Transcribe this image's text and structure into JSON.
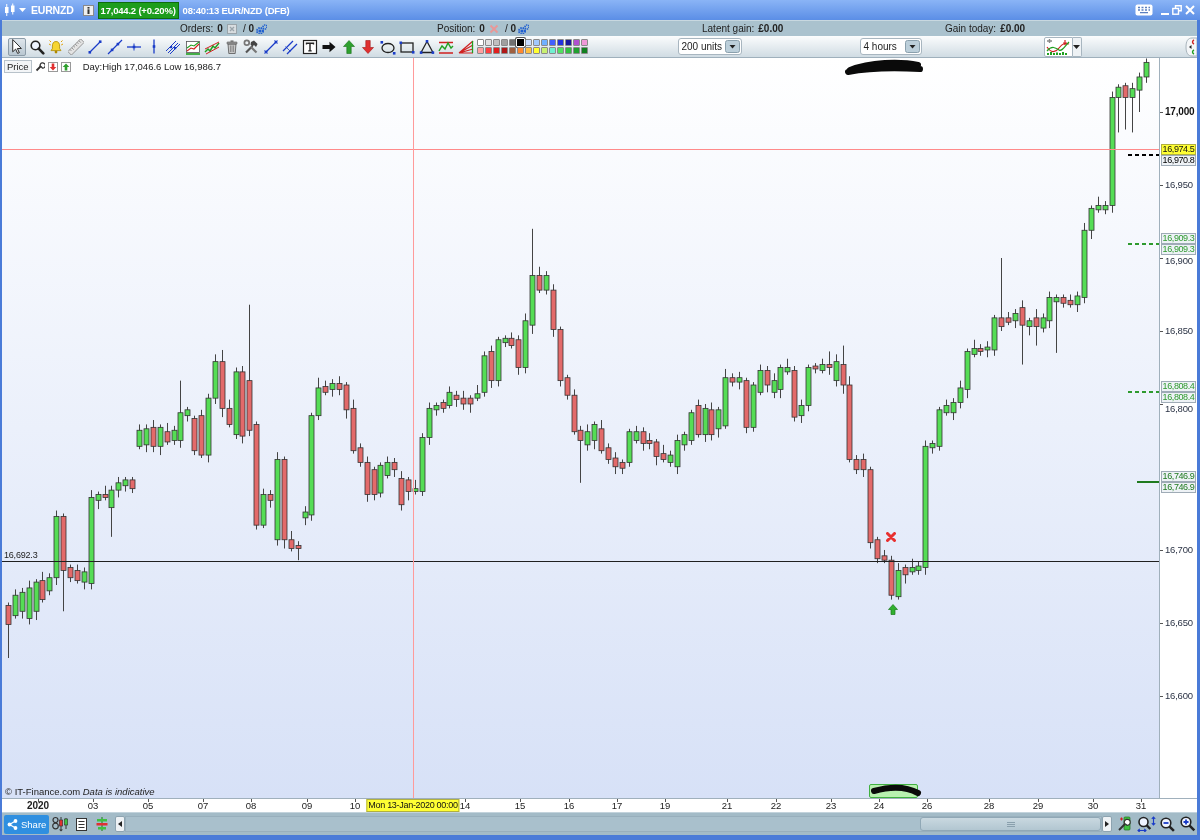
{
  "title_bar": {
    "instrument": "EURNZD",
    "quote": "17,044.2 (+0.20%)",
    "time_market": "08:40:13 EUR/NZD (DFB)"
  },
  "info_bar": [
    {
      "kind": "orders",
      "label": "Orders:",
      "value": "0",
      "total": "/ **0**"
    },
    {
      "kind": "position",
      "label": "Position:",
      "value": "0",
      "total": "/ **0**"
    },
    {
      "kind": "gain",
      "label": "Latent gain:",
      "value": "£0.00"
    },
    {
      "kind": "gain",
      "label": "Gain today:",
      "value": "£0.00"
    }
  ],
  "toolbar": {
    "tools": [
      {
        "kind": "pointer",
        "selected": true
      },
      {
        "kind": "zoom",
        "selected": false
      },
      {
        "kind": "alarm",
        "selected": false
      },
      {
        "kind": "ruler",
        "selected": false
      },
      {
        "kind": "segment",
        "selected": false
      },
      {
        "kind": "line",
        "selected": false
      },
      {
        "kind": "horizontal",
        "selected": false
      },
      {
        "kind": "vertical",
        "selected": false
      },
      {
        "kind": "channel",
        "selected": false
      },
      {
        "kind": "regression",
        "selected": false
      },
      {
        "kind": "trend",
        "selected": false
      },
      {
        "kind": "delete",
        "selected": false
      },
      {
        "kind": "tools",
        "selected": false
      },
      {
        "kind": "diagonal",
        "selected": false
      },
      {
        "kind": "parallel",
        "selected": false
      },
      {
        "kind": "text",
        "selected": false
      },
      {
        "kind": "arrow",
        "selected": false
      },
      {
        "kind": "arrowup",
        "selected": false
      },
      {
        "kind": "arrowdown",
        "selected": false
      },
      {
        "kind": "ellipse",
        "selected": false
      },
      {
        "kind": "rectangle",
        "selected": false
      },
      {
        "kind": "triangle",
        "selected": false
      },
      {
        "kind": "fibonacci",
        "selected": false
      },
      {
        "kind": "fan",
        "selected": false
      }
    ],
    "palette": [
      {
        "color": "#ffffff",
        "selected": false
      },
      {
        "color": "#e0e0e0",
        "selected": false
      },
      {
        "color": "#c0c0c0",
        "selected": false
      },
      {
        "color": "#a0a0a0",
        "selected": false
      },
      {
        "color": "#707070",
        "selected": false
      },
      {
        "color": "#000000",
        "selected": true
      },
      {
        "color": "#c8dcff",
        "selected": false
      },
      {
        "color": "#a0c8ff",
        "selected": false
      },
      {
        "color": "#70b0ff",
        "selected": false
      },
      {
        "color": "#4060ff",
        "selected": false
      },
      {
        "color": "#2030e0",
        "selected": false
      },
      {
        "color": "#1818a0",
        "selected": false
      },
      {
        "color": "#b050d0",
        "selected": false
      },
      {
        "color": "#f098d8",
        "selected": false
      },
      {
        "color": "#ffa0a0",
        "selected": false
      },
      {
        "color": "#ff4040",
        "selected": false
      },
      {
        "color": "#e02020",
        "selected": false
      },
      {
        "color": "#b01818",
        "selected": false
      },
      {
        "color": "#a06040",
        "selected": false
      },
      {
        "color": "#ff8830",
        "selected": false
      },
      {
        "color": "#ffc040",
        "selected": false
      },
      {
        "color": "#ffff30",
        "selected": false
      },
      {
        "color": "#c8f070",
        "selected": false
      },
      {
        "color": "#70f0d0",
        "selected": false
      },
      {
        "color": "#50e060",
        "selected": false
      },
      {
        "color": "#30c040",
        "selected": false
      },
      {
        "color": "#20a030",
        "selected": false
      },
      {
        "color": "#108020",
        "selected": false
      }
    ],
    "quantity": {
      "value": "200 units"
    },
    "interval": {
      "value": "4 hours"
    }
  },
  "chart": {
    "header": {
      "label": "Price",
      "day_range": "Day:High 17,046.6 Low 16,986.7"
    },
    "chart_data": {
      "type": "candlestick",
      "categories": [
        null,
        null,
        null,
        null,
        "2020",
        null,
        null,
        null,
        null,
        null,
        null,
        null,
        "03",
        null,
        null,
        null,
        null,
        null,
        null,
        null,
        "05",
        null,
        null,
        null,
        null,
        null,
        null,
        null,
        "07",
        null,
        null,
        null,
        null,
        null,
        null,
        "08",
        null,
        null,
        null,
        null,
        null,
        null,
        null,
        "09",
        null,
        null,
        null,
        null,
        null,
        null,
        "10",
        null,
        null,
        null,
        null,
        null,
        null,
        null,
        null,
        null,
        null,
        null,
        null,
        null,
        null,
        null,
        "14",
        null,
        null,
        null,
        null,
        null,
        null,
        null,
        "15",
        null,
        null,
        null,
        null,
        null,
        null,
        "16",
        null,
        null,
        null,
        null,
        null,
        null,
        "17",
        null,
        null,
        null,
        null,
        null,
        null,
        "19",
        null,
        null,
        null,
        null,
        null,
        null,
        null,
        null,
        "21",
        null,
        null,
        null,
        null,
        null,
        null,
        "22",
        null,
        null,
        null,
        null,
        null,
        null,
        null,
        "23",
        null,
        null,
        null,
        null,
        null,
        null,
        "24",
        null,
        null,
        null,
        null,
        null,
        null,
        "26",
        null,
        null,
        null,
        null,
        null,
        null,
        null,
        null,
        "28",
        null,
        null,
        null,
        null,
        null,
        null,
        "29",
        null,
        null,
        null,
        null,
        null,
        null,
        null,
        "30",
        null,
        null,
        null,
        null,
        null,
        null,
        "31",
        null
      ],
      "ohlc": [
        [
          16662,
          16664,
          16626,
          16649
        ],
        [
          16655,
          16673,
          16653,
          16669
        ],
        [
          16658,
          16674,
          16653,
          16671
        ],
        [
          16653,
          16679,
          16649,
          16674
        ],
        [
          16658,
          16680,
          16652,
          16678
        ],
        [
          16679,
          16685,
          16664,
          16666
        ],
        [
          16672,
          16684,
          16669,
          16681
        ],
        [
          16681,
          16727,
          16676,
          16723
        ],
        [
          16723,
          16725,
          16658,
          16686
        ],
        [
          16688,
          16690,
          16678,
          16681
        ],
        [
          16686,
          16690,
          16677,
          16679
        ],
        [
          16678,
          16688,
          16673,
          16685
        ],
        [
          16677,
          16741,
          16673,
          16736
        ],
        [
          16734,
          16740,
          16728,
          16738
        ],
        [
          16738,
          16744,
          16734,
          16736
        ],
        [
          16729,
          16744,
          16709,
          16741
        ],
        [
          16741,
          16750,
          16736,
          16746
        ],
        [
          16744,
          16750,
          16740,
          16748
        ],
        [
          16748,
          16750,
          16739,
          16742
        ],
        [
          16771,
          16786,
          16769,
          16782
        ],
        [
          16772,
          16786,
          16767,
          16783
        ],
        [
          16784,
          16789,
          16767,
          16771
        ],
        [
          16771,
          16786,
          16765,
          16784
        ],
        [
          16781,
          16787,
          16772,
          16774
        ],
        [
          16775,
          16785,
          16772,
          16782
        ],
        [
          16775,
          16816,
          16770,
          16794
        ],
        [
          16792,
          16798,
          16788,
          16796
        ],
        [
          16790,
          16792,
          16765,
          16768
        ],
        [
          16792,
          16796,
          16763,
          16765
        ],
        [
          16765,
          16807,
          16760,
          16804
        ],
        [
          16804,
          16834,
          16800,
          16829
        ],
        [
          16829,
          16837,
          16791,
          16797
        ],
        [
          16797,
          16803,
          16784,
          16786
        ],
        [
          16779,
          16825,
          16776,
          16822
        ],
        [
          16822,
          16826,
          16773,
          16778
        ],
        [
          16816,
          16868,
          16778,
          16782
        ],
        [
          16786,
          16788,
          16714,
          16717
        ],
        [
          16717,
          16742,
          16715,
          16738
        ],
        [
          16738,
          16741,
          16729,
          16734
        ],
        [
          16707,
          16767,
          16703,
          16762
        ],
        [
          16762,
          16764,
          16701,
          16707
        ],
        [
          16707,
          16713,
          16699,
          16701
        ],
        [
          16703,
          16706,
          16693,
          16701
        ],
        [
          16722,
          16730,
          16717,
          16726
        ],
        [
          16724,
          16794,
          16720,
          16792
        ],
        [
          16792,
          16818,
          16789,
          16811
        ],
        [
          16812,
          16816,
          16806,
          16808
        ],
        [
          16810,
          16817,
          16805,
          16814
        ],
        [
          16814,
          16819,
          16806,
          16810
        ],
        [
          16813,
          16815,
          16790,
          16796
        ],
        [
          16797,
          16803,
          16766,
          16768
        ],
        [
          16770,
          16773,
          16757,
          16760
        ],
        [
          16760,
          16764,
          16733,
          16738
        ],
        [
          16755,
          16757,
          16734,
          16738
        ],
        [
          16739,
          16760,
          16736,
          16758
        ],
        [
          16751,
          16764,
          16749,
          16760
        ],
        [
          16760,
          16763,
          16750,
          16755
        ],
        [
          16749,
          16754,
          16727,
          16731
        ],
        [
          16748,
          16750,
          16734,
          16740
        ],
        [
          16740,
          16748,
          16738,
          16742
        ],
        [
          16740,
          16780,
          16737,
          16777
        ],
        [
          16777,
          16801,
          16772,
          16797
        ],
        [
          16796,
          16801,
          16792,
          16799
        ],
        [
          16801,
          16803,
          16794,
          16797
        ],
        [
          16799,
          16812,
          16797,
          16808
        ],
        [
          16806,
          16809,
          16798,
          16803
        ],
        [
          16804,
          16809,
          16796,
          16800
        ],
        [
          16804,
          16806,
          16794,
          16800
        ],
        [
          16804,
          16813,
          16802,
          16807
        ],
        [
          16808,
          16836,
          16805,
          16833
        ],
        [
          16836,
          16840,
          16811,
          16816
        ],
        [
          16816,
          16846,
          16812,
          16844
        ],
        [
          16842,
          16847,
          16839,
          16845
        ],
        [
          16845,
          16849,
          16838,
          16840
        ],
        [
          16844,
          16847,
          16820,
          16825
        ],
        [
          16825,
          16862,
          16821,
          16857
        ],
        [
          16854,
          16920,
          16848,
          16888
        ],
        [
          16888,
          16894,
          16876,
          16878
        ],
        [
          16878,
          16891,
          16875,
          16888
        ],
        [
          16878,
          16882,
          16846,
          16851
        ],
        [
          16851,
          16853,
          16812,
          16816
        ],
        [
          16818,
          16820,
          16803,
          16806
        ],
        [
          16806,
          16810,
          16779,
          16781
        ],
        [
          16782,
          16785,
          16746,
          16775
        ],
        [
          16772,
          16786,
          16768,
          16781
        ],
        [
          16775,
          16788,
          16769,
          16786
        ],
        [
          16783,
          16789,
          16766,
          16768
        ],
        [
          16770,
          16773,
          16759,
          16762
        ],
        [
          16763,
          16767,
          16752,
          16757
        ],
        [
          16760,
          16762,
          16752,
          16756
        ],
        [
          16760,
          16783,
          16757,
          16781
        ],
        [
          16775,
          16785,
          16773,
          16781
        ],
        [
          16781,
          16784,
          16768,
          16773
        ],
        [
          16775,
          16780,
          16769,
          16773
        ],
        [
          16774,
          16776,
          16758,
          16764
        ],
        [
          16766,
          16772,
          16760,
          16762
        ],
        [
          16760,
          16768,
          16757,
          16765
        ],
        [
          16757,
          16779,
          16752,
          16775
        ],
        [
          16772,
          16781,
          16768,
          16779
        ],
        [
          16775,
          16796,
          16772,
          16794
        ],
        [
          16799,
          16803,
          16777,
          16779
        ],
        [
          16779,
          16800,
          16774,
          16797
        ],
        [
          16796,
          16801,
          16775,
          16779
        ],
        [
          16783,
          16798,
          16777,
          16796
        ],
        [
          16785,
          16824,
          16783,
          16818
        ],
        [
          16818,
          16821,
          16812,
          16815
        ],
        [
          16815,
          16822,
          16810,
          16818
        ],
        [
          16816,
          16818,
          16780,
          16784
        ],
        [
          16784,
          16815,
          16781,
          16813
        ],
        [
          16808,
          16827,
          16806,
          16823
        ],
        [
          16823,
          16826,
          16808,
          16813
        ],
        [
          16808,
          16821,
          16804,
          16816
        ],
        [
          16810,
          16827,
          16804,
          16825
        ],
        [
          16822,
          16831,
          16820,
          16825
        ],
        [
          16823,
          16826,
          16788,
          16791
        ],
        [
          16792,
          16803,
          16787,
          16799
        ],
        [
          16799,
          16827,
          16795,
          16825
        ],
        [
          16826,
          16828,
          16821,
          16824
        ],
        [
          16823,
          16831,
          16821,
          16827
        ],
        [
          16827,
          16836,
          16820,
          16825
        ],
        [
          16816,
          16834,
          16812,
          16829
        ],
        [
          16827,
          16840,
          16807,
          16813
        ],
        [
          16813,
          16819,
          16760,
          16762
        ],
        [
          16762,
          16765,
          16752,
          16755
        ],
        [
          16762,
          16766,
          16750,
          16755
        ],
        [
          16755,
          16757,
          16701,
          16705
        ],
        [
          16707,
          16709,
          16691,
          16694
        ],
        [
          16696,
          16700,
          16691,
          16693
        ],
        [
          16693,
          16696,
          16666,
          16669
        ],
        [
          16668,
          16691,
          16666,
          16686
        ],
        [
          16688,
          16690,
          16677,
          16683
        ],
        [
          16685,
          16694,
          16683,
          16688
        ],
        [
          16686,
          16692,
          16683,
          16689
        ],
        [
          16688,
          16775,
          16683,
          16771
        ],
        [
          16770,
          16775,
          16766,
          16773
        ],
        [
          16771,
          16798,
          16768,
          16796
        ],
        [
          16794,
          16803,
          16792,
          16799
        ],
        [
          16794,
          16804,
          16789,
          16801
        ],
        [
          16801,
          16816,
          16797,
          16811
        ],
        [
          16810,
          16838,
          16804,
          16836
        ],
        [
          16834,
          16844,
          16832,
          16838
        ],
        [
          16838,
          16841,
          16833,
          16836
        ],
        [
          16837,
          16843,
          16832,
          16839
        ],
        [
          16837,
          16861,
          16833,
          16859
        ],
        [
          16859,
          16900,
          16850,
          16853
        ],
        [
          16859,
          16863,
          16854,
          16856
        ],
        [
          16857,
          16865,
          16852,
          16862
        ],
        [
          16866,
          16871,
          16827,
          16854
        ],
        [
          16853,
          16859,
          16847,
          16857
        ],
        [
          16859,
          16865,
          16840,
          16853
        ],
        [
          16852,
          16862,
          16849,
          16859
        ],
        [
          16857,
          16877,
          16852,
          16873
        ],
        [
          16870,
          16875,
          16835,
          16873
        ],
        [
          16873,
          16875,
          16866,
          16869
        ],
        [
          16871,
          16875,
          16866,
          16868
        ],
        [
          16868,
          16877,
          16863,
          16874
        ],
        [
          16873,
          16924,
          16869,
          16919
        ],
        [
          16919,
          16936,
          16913,
          16934
        ],
        [
          16933,
          16942,
          16931,
          16936
        ],
        [
          16933,
          16939,
          16930,
          16936
        ],
        [
          16936,
          17014,
          16931,
          17010
        ],
        [
          17010,
          17019,
          16986,
          17017
        ],
        [
          17018,
          17020,
          16988,
          17010
        ],
        [
          17010,
          17020,
          16986,
          17016
        ],
        [
          17015,
          17027,
          17000,
          17024
        ],
        [
          17024,
          17039,
          17020,
          17034
        ]
      ],
      "ylim": [
        16530.1,
        17037.0
      ],
      "yticks": [
        {
          "value": 17000,
          "label": "17,000"
        },
        {
          "value": 16950,
          "label": "16,950"
        },
        {
          "value": 16900,
          "label": "16,900"
        },
        {
          "value": 16850,
          "label": "16,850"
        },
        {
          "value": 16800,
          "label": "16,800"
        },
        {
          "value": 16700,
          "label": "16,700"
        },
        {
          "value": 16650,
          "label": "16,650"
        },
        {
          "value": 16600,
          "label": "16,600"
        }
      ],
      "ref_lines": [
        {
          "axis": "y",
          "value": 16974.5,
          "color": "#ff8a8a"
        },
        {
          "axis": "y",
          "value": 16692.3,
          "color": "#202020",
          "label": "16,692.3"
        }
      ]
    },
    "crosshair": {
      "price": "16,974.5",
      "date": "Mon 13-Jan-2020 00:00"
    },
    "levels": [
      {
        "kind": "dashed",
        "color": "#000000",
        "tags": [
          "16,970.8"
        ]
      },
      {
        "kind": "dashed",
        "color": "#2e9a2e",
        "tags": [
          "16,909.3",
          "16,909.3"
        ]
      },
      {
        "kind": "dashed",
        "color": "#2e9a2e",
        "tags": [
          "16,808.4",
          "16,808.4"
        ]
      },
      {
        "kind": "solid",
        "color": "#1f7a1f",
        "tags": [
          "16,746.9",
          "16,746.9"
        ]
      }
    ],
    "notice": "© IT-Finance.com *Data is indicative*"
  },
  "bottom_bar": {
    "share_button": "Share"
  }
}
